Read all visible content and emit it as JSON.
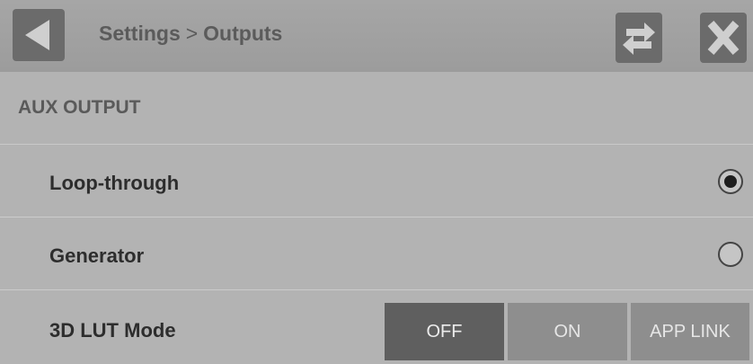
{
  "header": {
    "breadcrumb_root": "Settings",
    "breadcrumb_separator": ">",
    "breadcrumb_current": "Outputs",
    "back_icon": "back-arrow-icon",
    "swap_icon": "swap-arrows-icon",
    "close_icon": "close-x-icon"
  },
  "section": {
    "title": "AUX OUTPUT"
  },
  "options": [
    {
      "label": "Loop-through",
      "selected": true
    },
    {
      "label": "Generator",
      "selected": false
    }
  ],
  "lut_mode": {
    "label": "3D LUT Mode",
    "choices": [
      "OFF",
      "ON",
      "APP LINK"
    ],
    "selected": "OFF"
  },
  "colors": {
    "background": "#b5b5b5",
    "header": "#a0a0a0",
    "button": "#6b6b6b",
    "segment_selected": "#5f5f5f",
    "segment_unselected": "#8e8e8e"
  }
}
